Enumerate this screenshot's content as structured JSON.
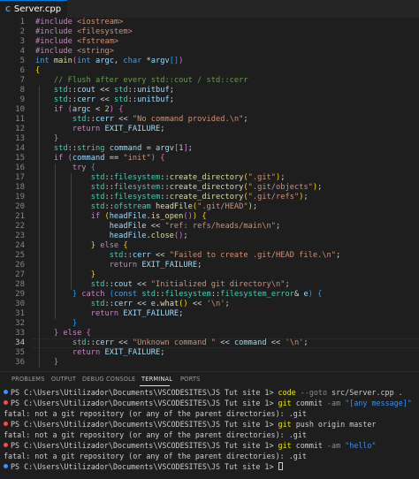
{
  "tab": {
    "label": "Server.cpp",
    "icon": "C"
  },
  "active_line": 34,
  "line_numbers": [
    "1",
    "2",
    "3",
    "4",
    "5",
    "6",
    "7",
    "8",
    "9",
    "10",
    "11",
    "12",
    "13",
    "14",
    "15",
    "16",
    "17",
    "18",
    "19",
    "20",
    "21",
    "22",
    "23",
    "24",
    "25",
    "26",
    "27",
    "28",
    "29",
    "30",
    "31",
    "32",
    "33",
    "34",
    "35",
    "36"
  ],
  "code": [
    [
      [
        "pp",
        "#include "
      ],
      [
        "str",
        "<iostream>"
      ]
    ],
    [
      [
        "pp",
        "#include "
      ],
      [
        "str",
        "<filesystem>"
      ]
    ],
    [
      [
        "pp",
        "#include "
      ],
      [
        "str",
        "<fstream>"
      ]
    ],
    [
      [
        "pp",
        "#include "
      ],
      [
        "str",
        "<string>"
      ]
    ],
    [
      [
        "kw",
        "int "
      ],
      [
        "fn",
        "main"
      ],
      [
        "br2",
        "("
      ],
      [
        "kw",
        "int "
      ],
      [
        "var",
        "argc"
      ],
      [
        "pl",
        ", "
      ],
      [
        "kw",
        "char "
      ],
      [
        "pl",
        "*"
      ],
      [
        "var",
        "argv"
      ],
      [
        "br3",
        "[]"
      ],
      [
        "br2",
        ")"
      ]
    ],
    [
      [
        "br1",
        "{"
      ]
    ],
    [
      [
        "pl",
        "    "
      ],
      [
        "cm",
        "// Flush after every std::cout / std::cerr"
      ]
    ],
    [
      [
        "pl",
        "    "
      ],
      [
        "ty",
        "std"
      ],
      [
        "pl",
        "::"
      ],
      [
        "var",
        "cout"
      ],
      [
        "pl",
        " << "
      ],
      [
        "ty",
        "std"
      ],
      [
        "pl",
        "::"
      ],
      [
        "var",
        "unitbuf"
      ],
      [
        "pl",
        ";"
      ]
    ],
    [
      [
        "pl",
        "    "
      ],
      [
        "ty",
        "std"
      ],
      [
        "pl",
        "::"
      ],
      [
        "var",
        "cerr"
      ],
      [
        "pl",
        " << "
      ],
      [
        "ty",
        "std"
      ],
      [
        "pl",
        "::"
      ],
      [
        "var",
        "unitbuf"
      ],
      [
        "pl",
        ";"
      ]
    ],
    [
      [
        "pl",
        "    "
      ],
      [
        "ctl",
        "if "
      ],
      [
        "br2",
        "("
      ],
      [
        "var",
        "argc"
      ],
      [
        "pl",
        " < "
      ],
      [
        "num",
        "2"
      ],
      [
        "br2",
        ")"
      ],
      [
        "pl",
        " "
      ],
      [
        "br2",
        "{"
      ]
    ],
    [
      [
        "pl",
        "        "
      ],
      [
        "ty",
        "std"
      ],
      [
        "pl",
        "::"
      ],
      [
        "var",
        "cerr"
      ],
      [
        "pl",
        " << "
      ],
      [
        "str",
        "\"No command provided.\\n\""
      ],
      [
        "pl",
        ";"
      ]
    ],
    [
      [
        "pl",
        "        "
      ],
      [
        "ctl",
        "return "
      ],
      [
        "var",
        "EXIT_FAILURE"
      ],
      [
        "pl",
        ";"
      ]
    ],
    [
      [
        "pl",
        "    "
      ],
      [
        "br2",
        "}"
      ]
    ],
    [
      [
        "pl",
        "    "
      ],
      [
        "ty",
        "std"
      ],
      [
        "pl",
        "::"
      ],
      [
        "ty",
        "string"
      ],
      [
        "pl",
        " "
      ],
      [
        "var",
        "command"
      ],
      [
        "pl",
        " = "
      ],
      [
        "var",
        "argv"
      ],
      [
        "br2",
        "["
      ],
      [
        "num",
        "1"
      ],
      [
        "br2",
        "]"
      ],
      [
        "pl",
        ";"
      ]
    ],
    [
      [
        "pl",
        "    "
      ],
      [
        "ctl",
        "if "
      ],
      [
        "br2",
        "("
      ],
      [
        "var",
        "command"
      ],
      [
        "pl",
        " == "
      ],
      [
        "str",
        "\"init\""
      ],
      [
        "br2",
        ")"
      ],
      [
        "pl",
        " "
      ],
      [
        "br2",
        "{"
      ]
    ],
    [
      [
        "pl",
        "        "
      ],
      [
        "ctl",
        "try "
      ],
      [
        "br3",
        "{"
      ]
    ],
    [
      [
        "pl",
        "            "
      ],
      [
        "ty",
        "std"
      ],
      [
        "pl",
        "::"
      ],
      [
        "ty",
        "filesystem"
      ],
      [
        "pl",
        "::"
      ],
      [
        "fn",
        "create_directory"
      ],
      [
        "br1",
        "("
      ],
      [
        "str",
        "\".git\""
      ],
      [
        "br1",
        ")"
      ],
      [
        "pl",
        ";"
      ]
    ],
    [
      [
        "pl",
        "            "
      ],
      [
        "ty",
        "std"
      ],
      [
        "pl",
        "::"
      ],
      [
        "ty",
        "filesystem"
      ],
      [
        "pl",
        "::"
      ],
      [
        "fn",
        "create_directory"
      ],
      [
        "br1",
        "("
      ],
      [
        "str",
        "\".git/objects\""
      ],
      [
        "br1",
        ")"
      ],
      [
        "pl",
        ";"
      ]
    ],
    [
      [
        "pl",
        "            "
      ],
      [
        "ty",
        "std"
      ],
      [
        "pl",
        "::"
      ],
      [
        "ty",
        "filesystem"
      ],
      [
        "pl",
        "::"
      ],
      [
        "fn",
        "create_directory"
      ],
      [
        "br1",
        "("
      ],
      [
        "str",
        "\".git/refs\""
      ],
      [
        "br1",
        ")"
      ],
      [
        "pl",
        ";"
      ]
    ],
    [
      [
        "pl",
        "            "
      ],
      [
        "ty",
        "std"
      ],
      [
        "pl",
        "::"
      ],
      [
        "ty",
        "ofstream"
      ],
      [
        "pl",
        " "
      ],
      [
        "fn",
        "headFile"
      ],
      [
        "br1",
        "("
      ],
      [
        "str",
        "\".git/HEAD\""
      ],
      [
        "br1",
        ")"
      ],
      [
        "pl",
        ";"
      ]
    ],
    [
      [
        "pl",
        "            "
      ],
      [
        "ctl",
        "if "
      ],
      [
        "br1",
        "("
      ],
      [
        "var",
        "headFile"
      ],
      [
        "pl",
        "."
      ],
      [
        "fn",
        "is_open"
      ],
      [
        "br2",
        "()"
      ],
      [
        "br1",
        ")"
      ],
      [
        "pl",
        " "
      ],
      [
        "br1",
        "{"
      ]
    ],
    [
      [
        "pl",
        "                "
      ],
      [
        "var",
        "headFile"
      ],
      [
        "pl",
        " << "
      ],
      [
        "str",
        "\"ref: refs/heads/main\\n\""
      ],
      [
        "pl",
        ";"
      ]
    ],
    [
      [
        "pl",
        "                "
      ],
      [
        "var",
        "headFile"
      ],
      [
        "pl",
        "."
      ],
      [
        "fn",
        "close"
      ],
      [
        "br2",
        "()"
      ],
      [
        "pl",
        ";"
      ]
    ],
    [
      [
        "pl",
        "            "
      ],
      [
        "br1",
        "}"
      ],
      [
        "pl",
        " "
      ],
      [
        "ctl",
        "else "
      ],
      [
        "br1",
        "{"
      ]
    ],
    [
      [
        "pl",
        "                "
      ],
      [
        "ty",
        "std"
      ],
      [
        "pl",
        "::"
      ],
      [
        "var",
        "cerr"
      ],
      [
        "pl",
        " << "
      ],
      [
        "str",
        "\"Failed to create .git/HEAD file.\\n\""
      ],
      [
        "pl",
        ";"
      ]
    ],
    [
      [
        "pl",
        "                "
      ],
      [
        "ctl",
        "return "
      ],
      [
        "var",
        "EXIT_FAILURE"
      ],
      [
        "pl",
        ";"
      ]
    ],
    [
      [
        "pl",
        "            "
      ],
      [
        "br1",
        "}"
      ]
    ],
    [
      [
        "pl",
        "            "
      ],
      [
        "ty",
        "std"
      ],
      [
        "pl",
        "::"
      ],
      [
        "var",
        "cout"
      ],
      [
        "pl",
        " << "
      ],
      [
        "str",
        "\"Initialized git directory\\n\""
      ],
      [
        "pl",
        ";"
      ]
    ],
    [
      [
        "pl",
        "        "
      ],
      [
        "br3",
        "}"
      ],
      [
        "pl",
        " "
      ],
      [
        "ctl",
        "catch "
      ],
      [
        "br3",
        "("
      ],
      [
        "kw",
        "const "
      ],
      [
        "ty",
        "std"
      ],
      [
        "pl",
        "::"
      ],
      [
        "ty",
        "filesystem"
      ],
      [
        "pl",
        "::"
      ],
      [
        "ty",
        "filesystem_error"
      ],
      [
        "pl",
        "& "
      ],
      [
        "var",
        "e"
      ],
      [
        "br3",
        ")"
      ],
      [
        "pl",
        " "
      ],
      [
        "br3",
        "{"
      ]
    ],
    [
      [
        "pl",
        "            "
      ],
      [
        "ty",
        "std"
      ],
      [
        "pl",
        "::"
      ],
      [
        "var",
        "cerr"
      ],
      [
        "pl",
        " << "
      ],
      [
        "var",
        "e"
      ],
      [
        "pl",
        "."
      ],
      [
        "fn",
        "what"
      ],
      [
        "br1",
        "()"
      ],
      [
        "pl",
        " << "
      ],
      [
        "str",
        "'\\n'"
      ],
      [
        "pl",
        ";"
      ]
    ],
    [
      [
        "pl",
        "            "
      ],
      [
        "ctl",
        "return "
      ],
      [
        "var",
        "EXIT_FAILURE"
      ],
      [
        "pl",
        ";"
      ]
    ],
    [
      [
        "pl",
        "        "
      ],
      [
        "br3",
        "}"
      ]
    ],
    [
      [
        "pl",
        "    "
      ],
      [
        "br2",
        "}"
      ],
      [
        "pl",
        " "
      ],
      [
        "ctl",
        "else "
      ],
      [
        "br2",
        "{"
      ]
    ],
    [
      [
        "pl",
        "        "
      ],
      [
        "ty",
        "std"
      ],
      [
        "pl",
        "::"
      ],
      [
        "var",
        "cerr"
      ],
      [
        "pl",
        " << "
      ],
      [
        "str",
        "\"Unknown command \""
      ],
      [
        "pl",
        " << "
      ],
      [
        "var",
        "command"
      ],
      [
        "pl",
        " << "
      ],
      [
        "str",
        "'\\n'"
      ],
      [
        "pl",
        ";"
      ]
    ],
    [
      [
        "pl",
        "        "
      ],
      [
        "ctl",
        "return "
      ],
      [
        "var",
        "EXIT_FAILURE"
      ],
      [
        "pl",
        ";"
      ]
    ],
    [
      [
        "pl",
        "    "
      ],
      [
        "br2",
        "}"
      ]
    ]
  ],
  "panel_tabs": [
    "PROBLEMS",
    "OUTPUT",
    "DEBUG CONSOLE",
    "TERMINAL",
    "PORTS"
  ],
  "active_panel_tab": "TERMINAL",
  "terminal": [
    {
      "dot": "blue",
      "parts": [
        [
          "pl",
          "PS C:\\Users\\Utilizador\\Documents\\VSCODESITES\\JS Tut site 1> "
        ],
        [
          "cmd",
          "code"
        ],
        [
          "flag",
          " --goto"
        ],
        [
          "pl",
          " src/Server.cpp ."
        ]
      ]
    },
    {
      "dot": "red",
      "parts": [
        [
          "pl",
          "PS C:\\Users\\Utilizador\\Documents\\VSCODESITES\\JS Tut site 1> "
        ],
        [
          "cmd",
          "git"
        ],
        [
          "pl",
          " commit "
        ],
        [
          "flag",
          "-am"
        ],
        [
          "str",
          " \"[any message]\""
        ]
      ]
    },
    {
      "dot": "",
      "parts": [
        [
          "pl",
          "fatal: not a git repository (or any of the parent directories): .git"
        ]
      ]
    },
    {
      "dot": "red",
      "parts": [
        [
          "pl",
          "PS C:\\Users\\Utilizador\\Documents\\VSCODESITES\\JS Tut site 1> "
        ],
        [
          "cmd",
          "git"
        ],
        [
          "pl",
          " push origin master"
        ]
      ]
    },
    {
      "dot": "",
      "parts": [
        [
          "pl",
          "fatal: not a git repository (or any of the parent directories): .git"
        ]
      ]
    },
    {
      "dot": "red",
      "parts": [
        [
          "pl",
          "PS C:\\Users\\Utilizador\\Documents\\VSCODESITES\\JS Tut site 1> "
        ],
        [
          "cmd",
          "git"
        ],
        [
          "pl",
          " commit "
        ],
        [
          "flag",
          "-am"
        ],
        [
          "str",
          " \"hello\""
        ]
      ]
    },
    {
      "dot": "",
      "parts": [
        [
          "pl",
          "fatal: not a git repository (or any of the parent directories): .git"
        ]
      ]
    },
    {
      "dot": "blue",
      "parts": [
        [
          "pl",
          "PS C:\\Users\\Utilizador\\Documents\\VSCODESITES\\JS Tut site 1> "
        ]
      ],
      "cursor": true
    }
  ],
  "colors": {
    "accent": "#0078d4",
    "editor_bg": "#1e1e1e",
    "tabbar_bg": "#252526",
    "error_dot": "#f14c4c",
    "info_dot": "#3794ff"
  }
}
